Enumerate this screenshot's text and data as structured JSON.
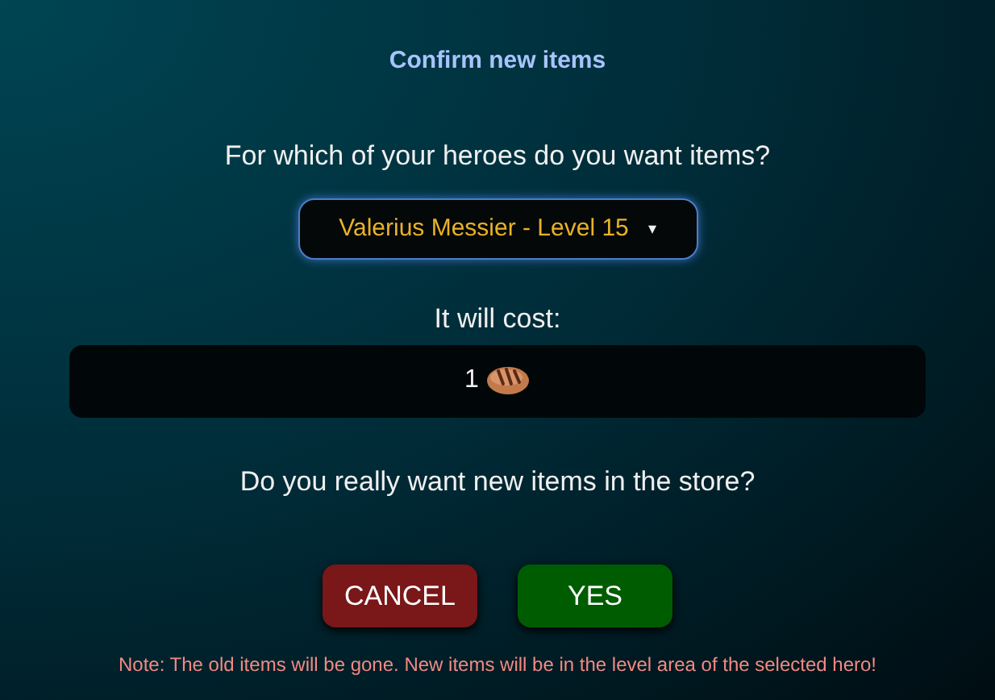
{
  "title": "Confirm new items",
  "hero_question": "For which of your heroes do you want items?",
  "hero_select": {
    "value": "Valerius Messier - Level 15",
    "caret": "▾"
  },
  "cost_label": "It will cost:",
  "cost_amount": "1",
  "confirm_question": "Do you really want new items in the store?",
  "buttons": [
    {
      "label": "CANCEL",
      "kind": "cancel"
    },
    {
      "label": "YES",
      "kind": "confirm"
    }
  ],
  "note": "Note: The old items will be gone. New items will be in the level area of the selected hero!"
}
